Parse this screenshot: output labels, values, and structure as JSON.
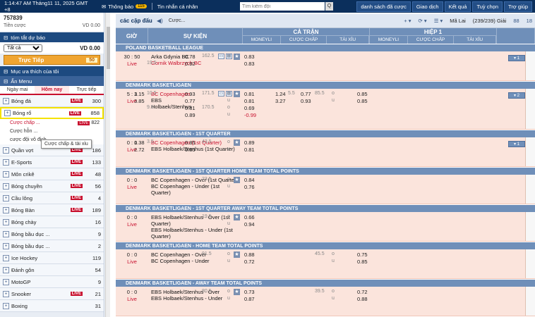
{
  "topbar": {
    "time": "1:14:47 AM Tháng11 11, 2025 GMT +8",
    "notif": "Thông báo",
    "notif_badge": "115",
    "messages": "Tin nhắn cá nhân",
    "search_placeholder": "Tìm kiếm đội",
    "search_btn": "Q",
    "buttons": [
      "danh sách đã cược",
      "Giao dịch",
      "Kết quả",
      "Tuỳ chọn",
      "Trợ giúp"
    ]
  },
  "account": {
    "id": "757839",
    "credit_label": "Tiền cược",
    "credit_value": "VD 0.00"
  },
  "summary": {
    "title": "tóm tắt dự báo",
    "filter": "Tất cả",
    "value": "VD 0.00"
  },
  "live": {
    "label": "Trực Tiếp",
    "count": "50"
  },
  "favorites": "Mục ưa thích của tôi",
  "hide_menu": "Ẩn Menu",
  "tabs": [
    "Ngày mai",
    "Hôm nay",
    "Trực tiếp"
  ],
  "sports": [
    {
      "name": "Bóng đá",
      "live": "LIVE",
      "count": "300"
    },
    {
      "name": "Bóng rổ",
      "live": "LIVE",
      "count": "858",
      "selected": true
    },
    {
      "name": "Quần vợt",
      "live": "LIVE",
      "count": "186"
    },
    {
      "name": "E-Sports",
      "live": "LIVE",
      "count": "133"
    },
    {
      "name": "Môn crikê",
      "live": "LIVE",
      "count": "48"
    },
    {
      "name": "Bóng chuyền",
      "live": "LIVE",
      "count": "56"
    },
    {
      "name": "Cầu lông",
      "live": "LIVE",
      "count": "4"
    },
    {
      "name": "Bóng Bàn",
      "live": "LIVE",
      "count": "189"
    },
    {
      "name": "Bóng chày",
      "live": "",
      "count": "16"
    },
    {
      "name": "Bóng bầu dục ...",
      "live": "",
      "count": "9"
    },
    {
      "name": "Bóng bầu dục ...",
      "live": "",
      "count": "2"
    },
    {
      "name": "Ice Hockey",
      "live": "",
      "count": "119"
    },
    {
      "name": "Đánh gôn",
      "live": "",
      "count": "54"
    },
    {
      "name": "MotoGP",
      "live": "",
      "count": "9"
    },
    {
      "name": "Snooker",
      "live": "LIVE",
      "count": "21"
    },
    {
      "name": "Boxing",
      "live": "",
      "count": "31"
    }
  ],
  "subs": [
    {
      "name": "Cược chấp ...",
      "live": "LIVE",
      "count": "822"
    },
    {
      "name": "Cược hỗn ..."
    },
    {
      "name": "cược đội vô địch"
    }
  ],
  "tooltip": "Cược chấp & tài xỉu",
  "main": {
    "title": "các cặp đấu",
    "select": "Cược...",
    "sort": "Mã Lai",
    "count": "(239/239) Giải",
    "views": "88",
    "fav": "18"
  },
  "header": {
    "time": "GIỜ",
    "event": "SỰ KIỆN",
    "full": "CẢ TRẬN",
    "half": "HIỆP 1",
    "sub": [
      "MONEYLI",
      "CƯỢC CHẤP",
      "TÀI XỈU"
    ]
  },
  "leagues": [
    {
      "name": "POLAND BASKETBALL LEAGUE",
      "matches": [
        {
          "time": "30 : 50",
          "live": "Live",
          "teams": [
            "Arka Gdynia BC",
            "Gornik Walbrzych BC"
          ],
          "red": [
            1
          ],
          "o": [
            [
              "",
              "",
              "",
              "0.78",
              "162.5",
              "u",
              "0.83",
              "",
              "",
              "",
              "",
              ""
            ],
            [
              "",
              "19.5",
              "",
              "0.92",
              "",
              "",
              "0.83",
              "",
              "",
              "",
              "",
              ""
            ]
          ],
          "plus": "1"
        }
      ]
    },
    {
      "name": "DENMARK BASKETLIGAEN",
      "matches": [
        {
          "time": "5 : 3",
          "live": "Live",
          "teams": [
            "BC Copenhagen",
            "EBS",
            "Holbaek/Stenhus"
          ],
          "red": [
            0
          ],
          "o": [
            [
              "1.15",
              "10.5",
              "",
              "0.93",
              "171.5",
              "o",
              "0.81",
              "1.24",
              "5.5",
              "0.77",
              "85.5",
              "o",
              "0.85"
            ],
            [
              "3.85",
              "",
              "",
              "0.77",
              "",
              "u",
              "0.81",
              "3.27",
              "",
              "0.93",
              "",
              "u",
              "0.85"
            ],
            [
              "",
              "9.5",
              "",
              "0.81",
              "170.5",
              "o",
              "0.69",
              "",
              "",
              "",
              "",
              "",
              ""
            ],
            [
              "",
              "",
              "",
              "0.89",
              "",
              "u",
              "-0.99",
              "",
              "",
              "",
              "",
              "",
              ""
            ]
          ],
          "plus": "2"
        }
      ]
    },
    {
      "name": "DENMARK BASKETLIGAEN - 1ST QUARTER",
      "matches": [
        {
          "time": "0 : 0",
          "live": "Live",
          "teams": [
            "BC Copenhagen (1st Quarter)",
            "EBS Holbaek/Stenhus (1st Quarter)"
          ],
          "red": [
            0
          ],
          "o": [
            [
              "1.38",
              "3.5",
              "",
              "0.85",
              "43.5",
              "o",
              "0.89"
            ],
            [
              "2.72",
              "",
              "",
              "0.85",
              "",
              "u",
              "0.81"
            ]
          ],
          "plus": "1"
        }
      ]
    },
    {
      "name": "DENMARK BASKETLIGAEN - 1ST QUARTER HOME TEAM TOTAL POINTS",
      "matches": [
        {
          "time": "0 : 0",
          "live": "Live",
          "teams": [
            "BC Copenhagen - Over (1st Quarter)",
            "BC Copenhagen - Under (1st Quarter)"
          ],
          "red": [],
          "o": [
            [
              "",
              "",
              "",
              "",
              "23.5",
              "o",
              "0.84"
            ],
            [
              "",
              "",
              "",
              "",
              "",
              "u",
              "0.76"
            ]
          ]
        }
      ]
    },
    {
      "name": "DENMARK BASKETLIGAEN - 1ST QUARTER AWAY TEAM TOTAL POINTS",
      "matches": [
        {
          "time": "0 : 0",
          "live": "Live",
          "teams": [
            "EBS Holbaek/Stenhus - Over (1st Quarter)",
            "EBS Holbaek/Stenhus - Under (1st Quarter)"
          ],
          "red": [],
          "o": [
            [
              "",
              "",
              "",
              "",
              "19.5",
              "o",
              "0.66"
            ],
            [
              "",
              "",
              "",
              "",
              "",
              "u",
              "0.94"
            ]
          ]
        }
      ]
    },
    {
      "name": "DENMARK BASKETLIGAEN - HOME TEAM TOTAL POINTS",
      "matches": [
        {
          "time": "0 : 0",
          "live": "Live",
          "teams": [
            "BC Copenhagen - Over",
            "BC Copenhagen - Under"
          ],
          "red": [],
          "o": [
            [
              "",
              "",
              "",
              "",
              "91.5",
              "o",
              "0.88",
              "",
              "",
              "",
              "45.5",
              "o",
              "0.75"
            ],
            [
              "",
              "",
              "",
              "",
              "",
              "u",
              "0.72",
              "",
              "",
              "",
              "",
              "u",
              "0.85"
            ]
          ]
        }
      ]
    },
    {
      "name": "DENMARK BASKETLIGAEN - AWAY TEAM TOTAL POINTS",
      "matches": [
        {
          "time": "0 : 0",
          "live": "Live",
          "teams": [
            "EBS Holbaek/Stenhus - Over",
            "EBS Holbaek/Stenhus - Under"
          ],
          "red": [],
          "o": [
            [
              "",
              "",
              "",
              "",
              "80.5",
              "o",
              "0.73",
              "",
              "",
              "",
              "39.5",
              "o",
              "0.72"
            ],
            [
              "",
              "",
              "",
              "",
              "",
              "u",
              "0.87",
              "",
              "",
              "",
              "",
              "u",
              "0.88"
            ]
          ]
        }
      ]
    }
  ]
}
